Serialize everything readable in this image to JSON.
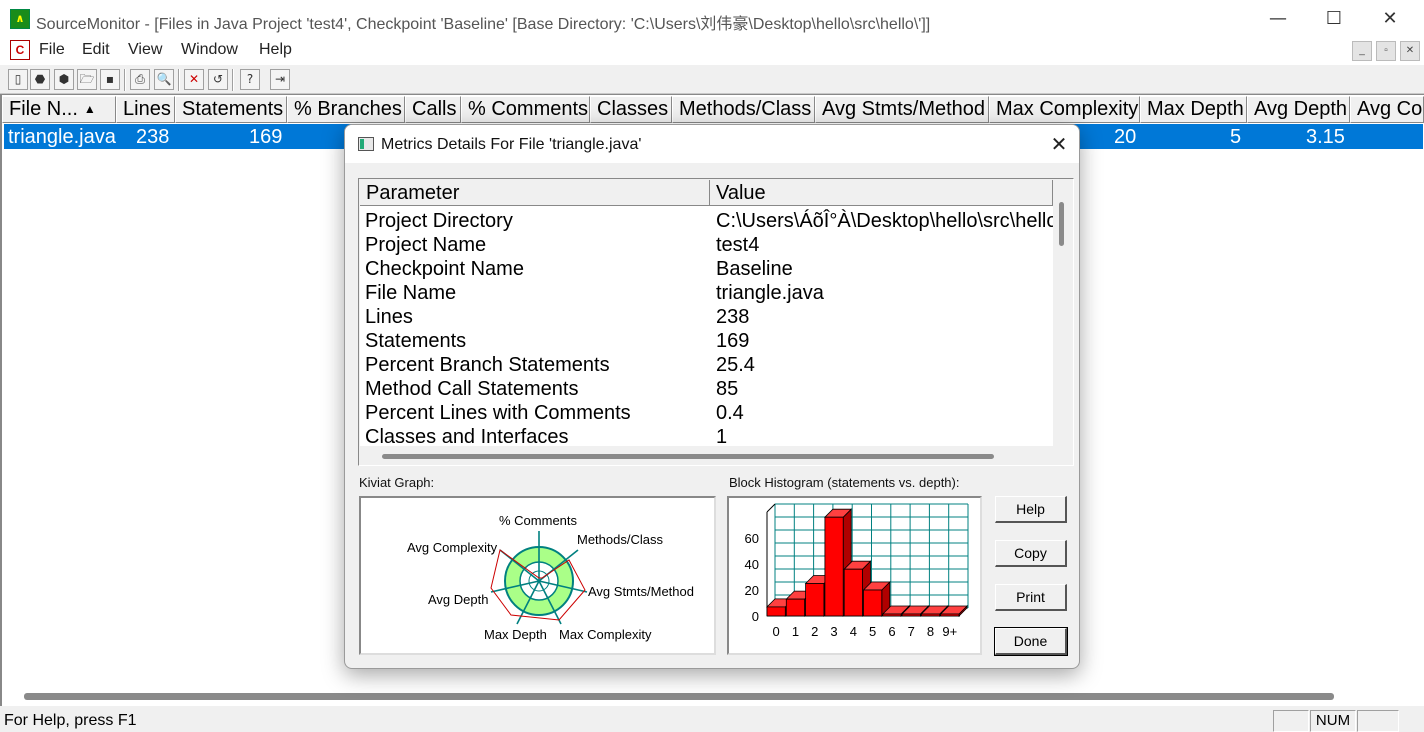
{
  "window": {
    "title": "SourceMonitor - [Files in Java Project 'test4', Checkpoint 'Baseline'  [Base Directory: 'C:\\Users\\刘伟豪\\Desktop\\hello\\src\\hello\\']]",
    "app_icon": "source-monitor-icon"
  },
  "menu": [
    "File",
    "Edit",
    "View",
    "Window",
    "Help"
  ],
  "table": {
    "columns": [
      "File N...",
      "Lines",
      "Statements",
      "% Branches",
      "Calls",
      "% Comments",
      "Classes",
      "Methods/Class",
      "Avg Stmts/Method",
      "Max Complexity",
      "Max Depth",
      "Avg Depth",
      "Avg Co"
    ],
    "row": {
      "file": "triangle.java",
      "lines": "238",
      "statements": "169",
      "max_complexity": "20",
      "max_depth": "5",
      "avg_depth": "3.15"
    }
  },
  "status": {
    "help": "For Help, press F1",
    "num": "NUM"
  },
  "dialog": {
    "title": "Metrics Details For File 'triangle.java'",
    "grid": {
      "header_param": "Parameter",
      "header_value": "Value",
      "rows": [
        {
          "p": "Project Directory",
          "v": "C:\\Users\\ÁõÎ°À\\Desktop\\hello\\src\\hello"
        },
        {
          "p": "Project Name",
          "v": "test4"
        },
        {
          "p": "Checkpoint Name",
          "v": "Baseline"
        },
        {
          "p": "File Name",
          "v": "triangle.java"
        },
        {
          "p": "Lines",
          "v": "238"
        },
        {
          "p": "Statements",
          "v": "169"
        },
        {
          "p": "Percent Branch Statements",
          "v": "25.4"
        },
        {
          "p": "Method Call Statements",
          "v": "85"
        },
        {
          "p": "Percent Lines with Comments",
          "v": "0.4"
        },
        {
          "p": "Classes and Interfaces",
          "v": "1"
        }
      ]
    },
    "kiviat": {
      "label": "Kiviat Graph:",
      "axes": [
        "% Comments",
        "Methods/Class",
        "Avg Stmts/Method",
        "Max Complexity",
        "Max Depth",
        "Avg Depth",
        "Avg Complexity"
      ]
    },
    "histogram": {
      "label": "Block Histogram (statements vs. depth):"
    },
    "buttons": {
      "help": "Help",
      "copy": "Copy",
      "print": "Print",
      "done": "Done"
    }
  },
  "chart_data": {
    "type": "bar",
    "title": "Block Histogram (statements vs. depth):",
    "categories": [
      "0",
      "1",
      "2",
      "3",
      "4",
      "5",
      "6",
      "7",
      "8",
      "9+"
    ],
    "values": [
      7,
      13,
      25,
      76,
      36,
      20,
      0,
      0,
      0,
      0
    ],
    "ylim": [
      0,
      80
    ],
    "yticks": [
      "0",
      "20",
      "40",
      "60"
    ],
    "grid": true,
    "bar_color": "#ff0000"
  },
  "colors": {
    "selection": "#0078d7",
    "kiviat_fill": "#aaff88",
    "kiviat_axis": "#008080",
    "histogram_grid": "#008080",
    "histogram_bar": "#ff0000"
  }
}
